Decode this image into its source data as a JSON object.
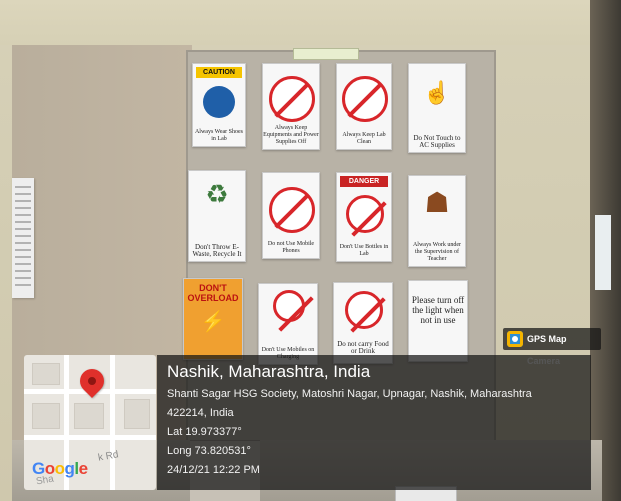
{
  "photo": {
    "board_label": "",
    "signs": [
      {
        "id": "s1",
        "caption": "Always Wear Shoes in Lab",
        "header": "CAUTION",
        "header_type": "caution",
        "symbol": "shoe-icon"
      },
      {
        "id": "s2",
        "caption": "Always Keep Equipments and Power Supplies Off",
        "header": "",
        "header_type": "",
        "symbol": "no-water-icon"
      },
      {
        "id": "s3",
        "caption": "Always Keep Lab Clean",
        "header": "",
        "header_type": "",
        "symbol": "no-litter-icon"
      },
      {
        "id": "s4",
        "caption": "Do Not Touch to AC Supplies",
        "header": "",
        "header_type": "",
        "symbol": "hand-icon"
      },
      {
        "id": "s5",
        "caption": "Don't Throw E-Waste, Recycle It",
        "header": "",
        "header_type": "",
        "symbol": "recycle-bin-icon"
      },
      {
        "id": "s6",
        "caption": "Do not Use Mobile Phones",
        "header": "",
        "header_type": "",
        "symbol": "no-device-icon"
      },
      {
        "id": "s7",
        "caption": "Don't Use Bottles in Lab",
        "header": "DANGER",
        "header_type": "danger",
        "symbol": "no-bottle-icon"
      },
      {
        "id": "s8",
        "caption": "Always Work under the Supervision of Teacher",
        "header": "",
        "header_type": "",
        "symbol": "teacher-icon"
      },
      {
        "id": "s9",
        "caption": "",
        "header": "DON'T OVERLOAD",
        "header_type": "",
        "symbol": "overload-icon"
      },
      {
        "id": "s10",
        "caption": "Don't Use Mobiles on Charging",
        "header": "",
        "header_type": "",
        "symbol": "no-charging-icon"
      },
      {
        "id": "s11",
        "caption": "Do not carry Food or Drink",
        "header": "",
        "header_type": "",
        "symbol": "no-food-icon"
      },
      {
        "id": "s12",
        "caption": "Please turn off the light when not in use",
        "header": "",
        "header_type": "",
        "symbol": "light-off-icon"
      }
    ]
  },
  "gps_badge": {
    "label": "GPS Map Camera",
    "icon": "camera-pin-icon"
  },
  "map": {
    "street_label_1": "k Rd",
    "street_label_2": "Sha",
    "logo_letters": [
      "G",
      "o",
      "o",
      "g",
      "l",
      "e"
    ],
    "pin_icon": "location-pin-icon"
  },
  "location": {
    "place": "Nashik, Maharashtra, India",
    "address_line1": "Shanti Sagar HSG Society, Matoshri Nagar, Upnagar, Nashik, Maharashtra",
    "address_line2": "422214, India",
    "lat": "Lat 19.973377°",
    "long": "Long 73.820531°",
    "datetime": "24/12/21 12:22 PM"
  },
  "colors": {
    "overlay_bg": "#141414",
    "pin": "#e0302b",
    "caution": "#f5c400",
    "danger": "#c92424",
    "prohibit": "#d8262a"
  }
}
